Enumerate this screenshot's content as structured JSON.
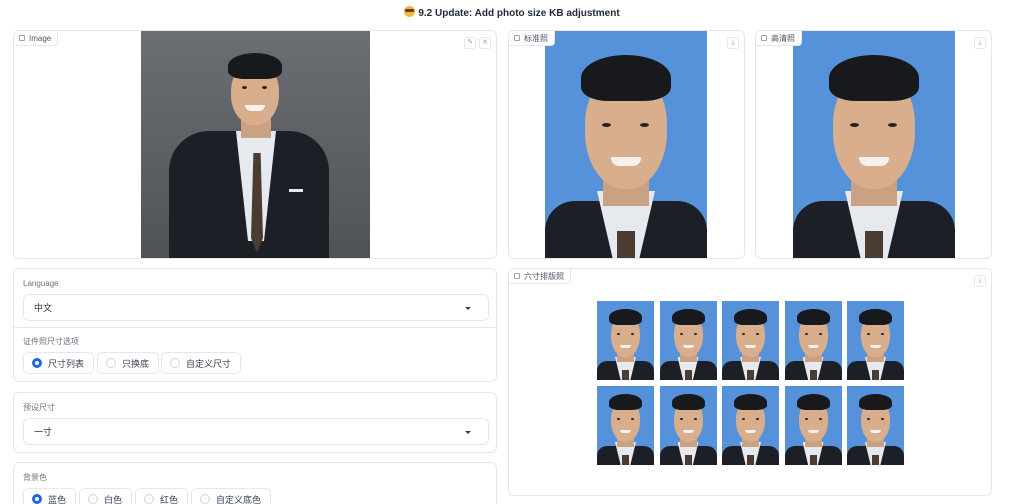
{
  "banner": {
    "emoji": "sunglasses-emoji",
    "text": "9.2 Update: Add photo size KB adjustment"
  },
  "image_panel": {
    "label": "Image",
    "edit_icon": "pencil-icon",
    "close_icon": "close-icon"
  },
  "standard_panel": {
    "label": "标准照",
    "download_icon": "download-icon"
  },
  "hd_panel": {
    "label": "高清照",
    "download_icon": "download-icon"
  },
  "layout_panel": {
    "label": "六寸排版照",
    "download_icon": "download-icon",
    "rows": 2,
    "cols": 5
  },
  "language": {
    "label": "Language",
    "value": "中文"
  },
  "size_options": {
    "label": "证件照尺寸选项",
    "options": [
      "尺寸列表",
      "只换底",
      "自定义尺寸"
    ],
    "selected": "尺寸列表"
  },
  "preset_size": {
    "label": "预设尺寸",
    "value": "一寸"
  },
  "background": {
    "label": "背景色",
    "options": [
      "蓝色",
      "白色",
      "红色",
      "自定义底色"
    ],
    "selected": "蓝色"
  },
  "colors": {
    "photo_bg": "#5592d9",
    "accent": "#2563eb"
  }
}
